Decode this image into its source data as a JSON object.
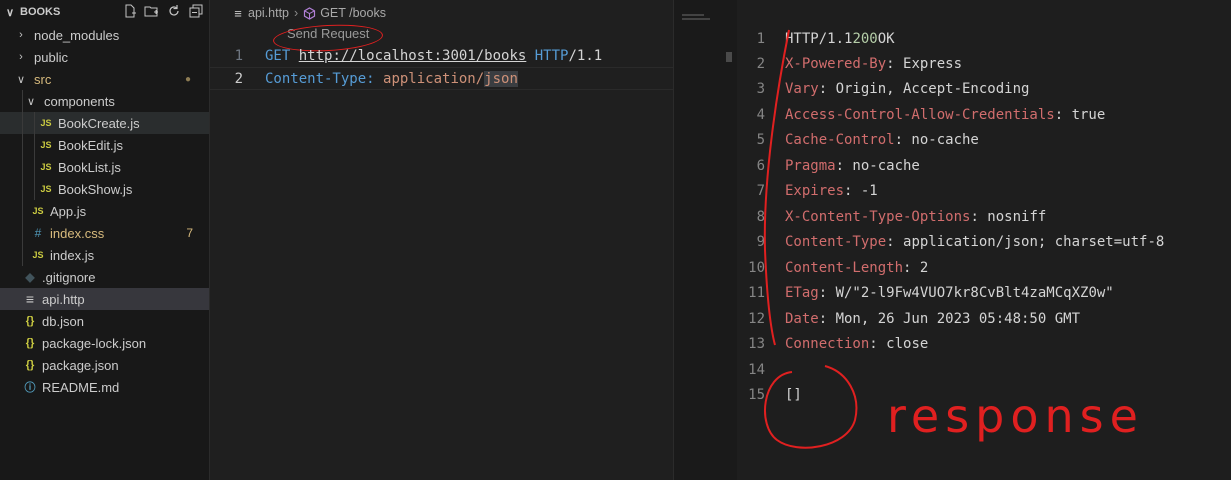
{
  "explorer": {
    "title": "BOOKS",
    "items": [
      {
        "label": "node_modules"
      },
      {
        "label": "public"
      },
      {
        "label": "src"
      },
      {
        "label": "components"
      },
      {
        "label": "BookCreate.js"
      },
      {
        "label": "BookEdit.js"
      },
      {
        "label": "BookList.js"
      },
      {
        "label": "BookShow.js"
      },
      {
        "label": "App.js"
      },
      {
        "label": "index.css",
        "badge": "7"
      },
      {
        "label": "index.js"
      },
      {
        "label": ".gitignore"
      },
      {
        "label": "api.http"
      },
      {
        "label": "db.json"
      },
      {
        "label": "package-lock.json"
      },
      {
        "label": "package.json"
      },
      {
        "label": "README.md"
      }
    ]
  },
  "editor": {
    "breadcrumb": {
      "file": "api.http",
      "symbol": "GET /books"
    },
    "codelens": "Send Request",
    "lines": [
      {
        "num": "1",
        "method": "GET",
        "url": "http://localhost:3001/books",
        "version": "HTTP/1.1"
      },
      {
        "num": "2",
        "header_name": "Content-Type:",
        "header_value_a": "application/",
        "header_value_b": "json"
      }
    ]
  },
  "response": {
    "lines": [
      {
        "num": "1",
        "a": "HTTP/1.1 ",
        "b": "200",
        "c": " OK"
      },
      {
        "num": "2",
        "key": "X-Powered-By",
        "val": ": Express"
      },
      {
        "num": "3",
        "key": "Vary",
        "val": ": Origin, Accept-Encoding"
      },
      {
        "num": "4",
        "key": "Access-Control-Allow-Credentials",
        "val": ": true"
      },
      {
        "num": "5",
        "key": "Cache-Control",
        "val": ": no-cache"
      },
      {
        "num": "6",
        "key": "Pragma",
        "val": ": no-cache"
      },
      {
        "num": "7",
        "key": "Expires",
        "val": ": -1"
      },
      {
        "num": "8",
        "key": "X-Content-Type-Options",
        "val": ": nosniff"
      },
      {
        "num": "9",
        "key": "Content-Type",
        "val": ": application/json; charset=utf-8"
      },
      {
        "num": "10",
        "key": "Content-Length",
        "val": ": 2"
      },
      {
        "num": "11",
        "key": "ETag",
        "val": ": W/\"2-l9Fw4VUO7kr8CvBlt4zaMCqXZ0w\""
      },
      {
        "num": "12",
        "key": "Date",
        "val": ": Mon, 26 Jun 2023 05:48:50 GMT"
      },
      {
        "num": "13",
        "key": "Connection",
        "val": ": close"
      },
      {
        "num": "14",
        "val": ""
      },
      {
        "num": "15",
        "val": "[]"
      }
    ],
    "annotation": "response"
  },
  "colors": {
    "annotation_red": "#e02020",
    "header_key": "#d16d6d",
    "status_code": "#b5cea8"
  }
}
